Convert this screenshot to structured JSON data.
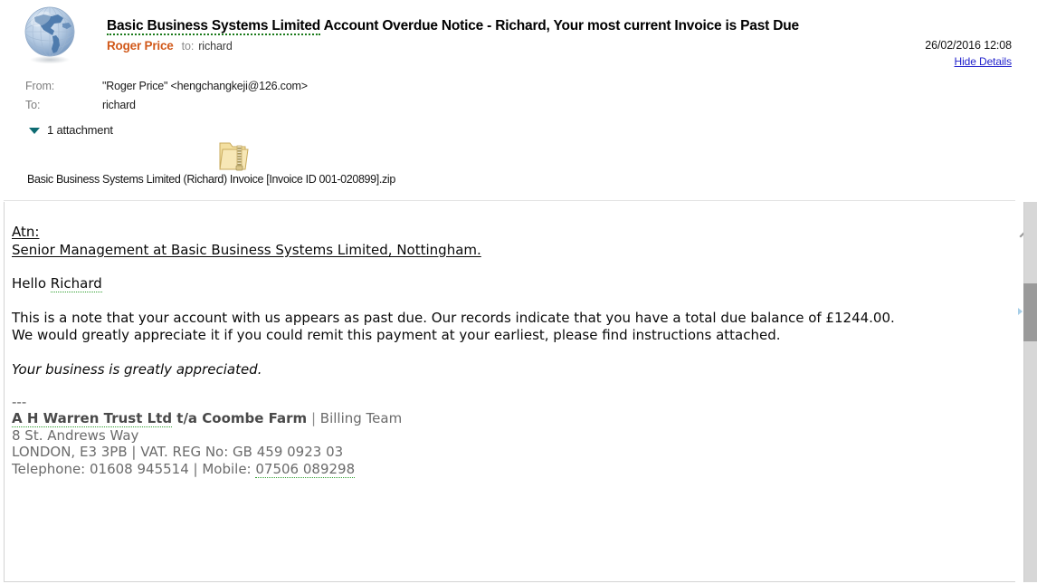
{
  "message": {
    "subject_spell_part": "Basic Business Systems Limited",
    "subject_rest": " Account Overdue Notice - Richard, Your most current Invoice is Past Due",
    "sender_name": "Roger Price",
    "to_label": "to:",
    "to_value": "richard",
    "date": "26/02/2016 12:08",
    "hide_details_label": "Hide Details",
    "avatar_icon": "globe-icon"
  },
  "details": {
    "rows": [
      {
        "label": "From:",
        "value": "\"Roger Price\" <hengchangkeji@126.com>"
      },
      {
        "label": "To:",
        "value": "richard"
      }
    ]
  },
  "attachments": {
    "toggle_label": "1 attachment",
    "toggle_icon": "triangle-down-icon",
    "file_icon": "zip-folder-icon",
    "items": [
      {
        "filename": "Basic Business Systems Limited (Richard) Invoice [Invoice ID 001-020899].zip"
      }
    ]
  },
  "body": {
    "atn_label": "Atn:",
    "atn_recipient": "Senior Management at Basic Business Systems Limited, Nottingham.",
    "greeting_prefix": "Hello ",
    "greeting_name": "Richard",
    "paragraph_line1": "This is a note that your account with us appears as past due. Our records indicate that you have a total due balance of £1244.00.",
    "paragraph_line2": "We would greatly appreciate it if you could remit this payment at your earliest, please find instructions attached.",
    "closing_italic": "Your business is greatly appreciated.",
    "signature_separator": "---",
    "signature_company": "A H Warren Trust Ltd",
    "signature_company_rest": " t/a Coombe Farm",
    "signature_pipe": " | ",
    "signature_department": "Billing Team",
    "signature_address": "8 St. Andrews Way",
    "signature_city_vat": "LONDON, E3 3PB | VAT. REG No: GB 459 0923 03",
    "signature_phone_label": "Telephone: 01608 945514 | Mobile: ",
    "signature_mobile": "07506 089298"
  },
  "scrollbar": {
    "up_icon": "chevron-up-icon",
    "marker_icon": "caret-right-icon"
  },
  "colors": {
    "sender_accent": "#d1591a",
    "link": "#2222cc",
    "spellcheck_underline": "#2f9e2f",
    "attachment_triangle": "#0d6b72",
    "scrollbar_thumb": "#9a9a9a"
  }
}
